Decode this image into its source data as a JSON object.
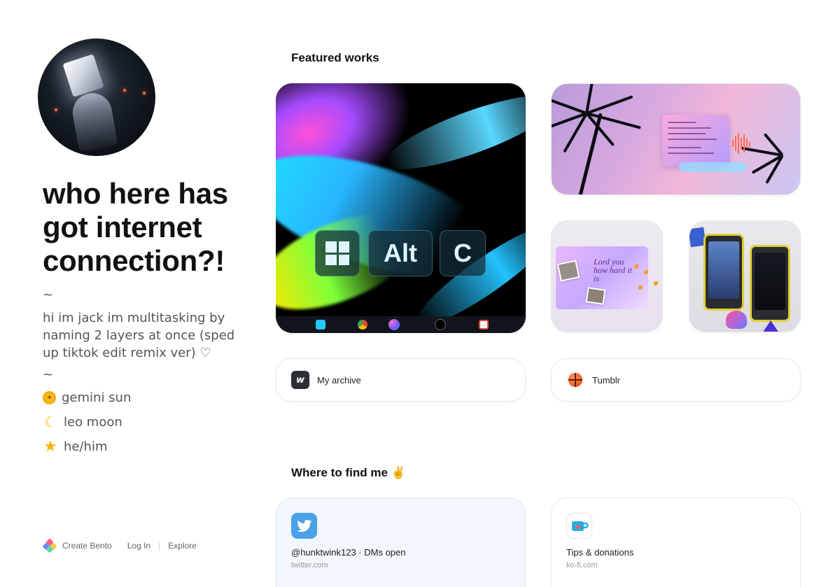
{
  "profile": {
    "headline": "who here has got internet connection?!",
    "bio_sep_1": "~",
    "bio_text": "hi im jack im multitasking by naming 2 layers at once (sped up tiktok edit remix ver) ♡",
    "bio_sep_2": "~",
    "traits": [
      {
        "icon": "sun-emoji-icon",
        "text": "gemini sun"
      },
      {
        "icon": "crescent-moon-emoji-icon",
        "text": "leo moon"
      },
      {
        "icon": "star-emoji-icon",
        "text": "he/him"
      }
    ]
  },
  "footer": {
    "create": "Create Bento",
    "login": "Log In",
    "separator": "|",
    "explore": "Explore"
  },
  "featured": {
    "title": "Featured works",
    "alt_c_keys": [
      "Alt",
      "C"
    ],
    "lord_text": "Lord you how hard it is"
  },
  "links": [
    {
      "icon": "w-logo-icon",
      "icon_letter": "w",
      "label": "My archive"
    },
    {
      "icon": "basketball-icon",
      "label": "Tumblr"
    }
  ],
  "find_me": {
    "title": "Where to find me ✌"
  },
  "socials": [
    {
      "icon": "twitter-bird-icon",
      "handle": "@hunktwink123 · DMs open",
      "domain": "twitter.com",
      "bg": "#f1f7fd",
      "icon_bg": "#4aa1e8"
    },
    {
      "icon": "ko-fi-cup-icon",
      "handle": "Tips & donations",
      "domain": "ko-fi.com",
      "bg": "#ffffff",
      "icon_bg": "#ffffff"
    }
  ],
  "colors": {
    "accent_twitter": "#4aa1e8",
    "text_primary": "#111111",
    "text_secondary": "#555555"
  }
}
